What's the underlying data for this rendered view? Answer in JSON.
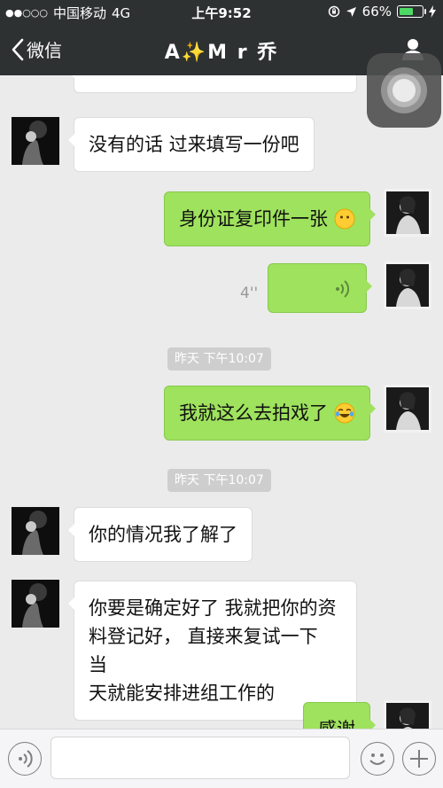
{
  "status_bar": {
    "carrier": "中国移动",
    "network": "4G",
    "time": "上午9:52",
    "battery": "66%",
    "battery_level": 0.66
  },
  "nav": {
    "back_label": "微信",
    "title": "A✨M r 乔",
    "icons": {
      "back": "chevron-left-icon",
      "profile": "person-icon"
    }
  },
  "messages": [
    {
      "side": "in",
      "text": "没有的话 过来填写一份吧"
    },
    {
      "side": "out",
      "text": "身份证复印件一张",
      "emoji": "neutral-face-emoji"
    },
    {
      "side": "out",
      "type": "voice",
      "duration": "4''"
    },
    {
      "type": "time",
      "text": "昨天 下午10:07"
    },
    {
      "side": "out",
      "text": "我就这么去拍戏了",
      "emoji": "tears-of-joy-emoji"
    },
    {
      "type": "time",
      "text": "昨天 下午10:07"
    },
    {
      "side": "in",
      "text": "你的情况我了解了"
    },
    {
      "side": "in",
      "lines": [
        "你要是确定好了 我就把你的资",
        "料登记好， 直接来复试一下 当",
        "天就能安排进组工作的"
      ]
    },
    {
      "side": "out",
      "text": "感谢"
    }
  ],
  "input_bar": {
    "icons": [
      "voice-icon",
      "emoji-icon",
      "plus-icon"
    ]
  },
  "colors": {
    "bar": "#2e3132",
    "chat_bg": "#ebebeb",
    "bubble_out": "#9fe25e",
    "bubble_in": "#ffffff",
    "battery_fill": "#4cd964"
  }
}
